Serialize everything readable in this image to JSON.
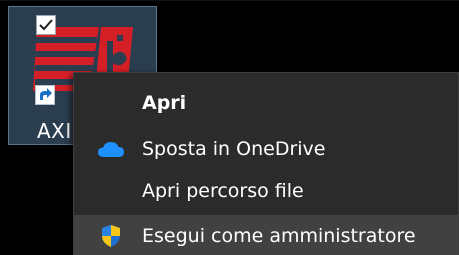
{
  "desktop": {
    "icon_label": "AXI"
  },
  "context_menu": {
    "items": [
      {
        "label": "Apri",
        "icon": "",
        "bold": true
      },
      {
        "label": "Sposta in OneDrive",
        "icon": "onedrive-cloud-icon"
      },
      {
        "label": "Apri percorso file",
        "icon": ""
      },
      {
        "label": "Esegui come amministratore",
        "icon": "uac-shield-icon",
        "highlighted": true
      }
    ]
  },
  "colors": {
    "desktop_bg": "#000000",
    "selection_bg": "#2b3e50",
    "selection_border": "#5c7692",
    "menu_bg": "#2b2b2b",
    "menu_hover": "#414141",
    "onedrive_blue": "#1e90ff",
    "logo_red": "#d51f26"
  }
}
